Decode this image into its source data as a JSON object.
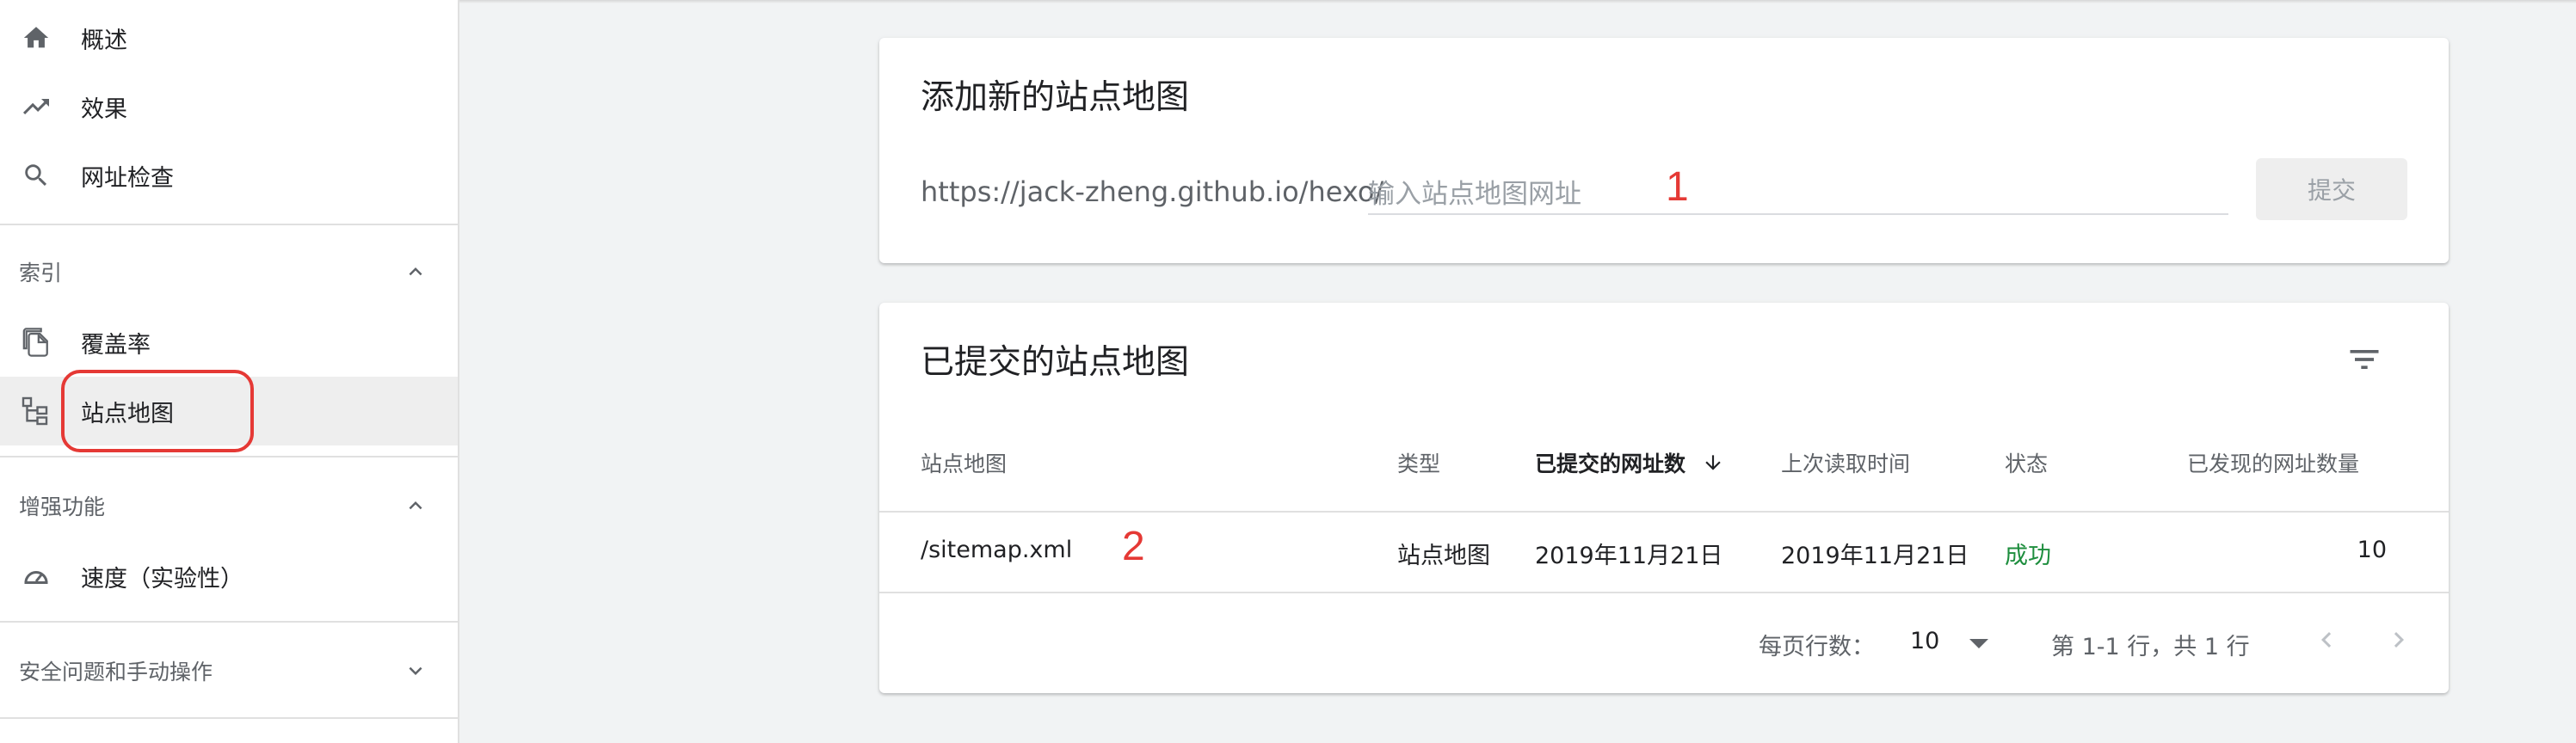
{
  "sidebar": {
    "items": [
      {
        "label": "概述",
        "icon": "home-icon"
      },
      {
        "label": "效果",
        "icon": "trending-up-icon"
      },
      {
        "label": "网址检查",
        "icon": "search-icon"
      }
    ],
    "sections": [
      {
        "title": "索引",
        "expanded": true,
        "items": [
          {
            "label": "覆盖率",
            "icon": "copy-pages-icon"
          },
          {
            "label": "站点地图",
            "icon": "sitemap-icon",
            "selected": true
          }
        ]
      },
      {
        "title": "增强功能",
        "expanded": true,
        "items": [
          {
            "label": "速度（实验性）",
            "icon": "speed-gauge-icon"
          }
        ]
      },
      {
        "title": "安全问题和手动操作",
        "expanded": false,
        "items": []
      }
    ]
  },
  "add_sitemap": {
    "title": "添加新的站点地图",
    "url_prefix": "https://jack-zheng.github.io/hexo/",
    "input_placeholder": "输入站点地图网址",
    "input_value": "",
    "submit_label": "提交",
    "annotation": "1"
  },
  "submitted": {
    "title": "已提交的站点地图",
    "filter_icon": "filter-list-icon",
    "columns": [
      "站点地图",
      "类型",
      "已提交的网址数",
      "上次读取时间",
      "状态",
      "已发现的网址数量"
    ],
    "sorted_column": "已提交的网址数",
    "rows": [
      {
        "sitemap": "/sitemap.xml",
        "type": "站点地图",
        "submitted": "2019年11月21日",
        "last_read": "2019年11月21日",
        "status": "成功",
        "discovered": "10"
      }
    ],
    "annotation": "2",
    "pagination": {
      "rows_per_page_label": "每页行数：",
      "rows_per_page_value": "10",
      "range_text": "第 1-1 行，共 1 行"
    }
  },
  "colors": {
    "success": "#1e8e3e",
    "annotation": "#e53935",
    "sidebar_selected": "#eeeeee",
    "background": "#f1f3f4"
  }
}
